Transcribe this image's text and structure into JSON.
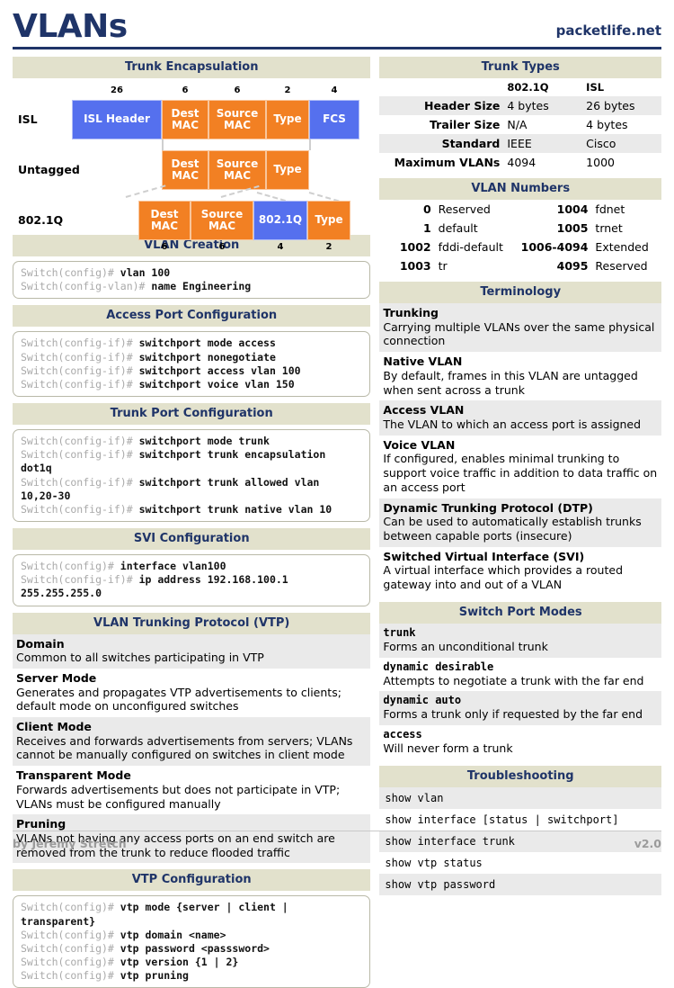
{
  "header": {
    "title": "VLANs",
    "brand": "packetlife.net",
    "accent_color": "#1F3468",
    "band_color": "#E2E1CC"
  },
  "trunk_encapsulation": {
    "heading": "Trunk Encapsulation",
    "rows": [
      {
        "label": "ISL",
        "fields": [
          {
            "text": "ISL Header",
            "size": "26",
            "color": "blue"
          },
          {
            "text": "Dest MAC",
            "size": "6",
            "color": "orange"
          },
          {
            "text": "Source MAC",
            "size": "6",
            "color": "orange"
          },
          {
            "text": "Type",
            "size": "2",
            "color": "orange"
          },
          {
            "text": "FCS",
            "size": "4",
            "color": "blue"
          }
        ]
      },
      {
        "label": "Untagged",
        "fields": [
          {
            "text": "Dest MAC",
            "size": "",
            "color": "orange"
          },
          {
            "text": "Source MAC",
            "size": "",
            "color": "orange"
          },
          {
            "text": "Type",
            "size": "",
            "color": "orange"
          }
        ]
      },
      {
        "label": "802.1Q",
        "fields": [
          {
            "text": "Dest MAC",
            "size": "6",
            "color": "orange"
          },
          {
            "text": "Source MAC",
            "size": "6",
            "color": "orange"
          },
          {
            "text": "802.1Q",
            "size": "4",
            "color": "blue"
          },
          {
            "text": "Type",
            "size": "2",
            "color": "orange"
          }
        ]
      }
    ]
  },
  "vlan_creation": {
    "heading": "VLAN Creation",
    "lines": [
      {
        "prompt": "Switch(config)#",
        "command": "vlan 100"
      },
      {
        "prompt": "Switch(config-vlan)#",
        "command": "name Engineering"
      }
    ]
  },
  "access_port": {
    "heading": "Access Port Configuration",
    "lines": [
      {
        "prompt": "Switch(config-if)#",
        "command": "switchport mode access"
      },
      {
        "prompt": "Switch(config-if)#",
        "command": "switchport nonegotiate"
      },
      {
        "prompt": "Switch(config-if)#",
        "command": "switchport access vlan 100"
      },
      {
        "prompt": "Switch(config-if)#",
        "command": "switchport voice vlan 150"
      }
    ]
  },
  "trunk_port": {
    "heading": "Trunk Port Configuration",
    "lines": [
      {
        "prompt": "Switch(config-if)#",
        "command": "switchport mode trunk"
      },
      {
        "prompt": "Switch(config-if)#",
        "command": "switchport trunk encapsulation dot1q"
      },
      {
        "prompt": "Switch(config-if)#",
        "command": "switchport trunk allowed vlan 10,20-30"
      },
      {
        "prompt": "Switch(config-if)#",
        "command": "switchport trunk native vlan 10"
      }
    ]
  },
  "svi": {
    "heading": "SVI Configuration",
    "lines": [
      {
        "prompt": "Switch(config)#",
        "command": "interface vlan100"
      },
      {
        "prompt": "Switch(config-if)#",
        "command": "ip address 192.168.100.1 255.255.255.0"
      }
    ]
  },
  "vtp": {
    "heading": "VLAN Trunking Protocol (VTP)",
    "entries": [
      {
        "term": "Domain",
        "desc": "Common to all switches participating in VTP"
      },
      {
        "term": "Server Mode",
        "desc": "Generates and propagates VTP advertisements to clients; default mode on unconfigured switches"
      },
      {
        "term": "Client Mode",
        "desc": "Receives and forwards advertisements from servers; VLANs cannot be manually configured on switches in client mode"
      },
      {
        "term": "Transparent Mode",
        "desc": "Forwards advertisements but does not participate in VTP; VLANs must be configured manually"
      },
      {
        "term": "Pruning",
        "desc": "VLANs not having any access ports on an end switch are removed from the trunk to reduce flooded traffic"
      }
    ]
  },
  "vtp_config": {
    "heading": "VTP Configuration",
    "lines": [
      {
        "prompt": "Switch(config)#",
        "command": "vtp mode {server | client | transparent}"
      },
      {
        "prompt": "Switch(config)#",
        "command": "vtp domain <name>"
      },
      {
        "prompt": "Switch(config)#",
        "command": "vtp password <passsword>"
      },
      {
        "prompt": "Switch(config)#",
        "command": "vtp version {1 | 2}"
      },
      {
        "prompt": "Switch(config)#",
        "command": "vtp pruning"
      }
    ]
  },
  "trunk_types": {
    "heading": "Trunk Types",
    "columns": [
      "",
      "802.1Q",
      "ISL"
    ],
    "rows": [
      {
        "label": "Header Size",
        "dot1q": "4 bytes",
        "isl": "26 bytes"
      },
      {
        "label": "Trailer Size",
        "dot1q": "N/A",
        "isl": "4 bytes"
      },
      {
        "label": "Standard",
        "dot1q": "IEEE",
        "isl": "Cisco"
      },
      {
        "label": "Maximum VLANs",
        "dot1q": "4094",
        "isl": "1000"
      }
    ]
  },
  "vlan_numbers": {
    "heading": "VLAN Numbers",
    "rows": [
      {
        "n1": "0",
        "v1": "Reserved",
        "n2": "1004",
        "v2": "fdnet"
      },
      {
        "n1": "1",
        "v1": "default",
        "n2": "1005",
        "v2": "trnet"
      },
      {
        "n1": "1002",
        "v1": "fddi-default",
        "n2": "1006-4094",
        "v2": "Extended"
      },
      {
        "n1": "1003",
        "v1": "tr",
        "n2": "4095",
        "v2": "Reserved"
      }
    ]
  },
  "terminology": {
    "heading": "Terminology",
    "entries": [
      {
        "term": "Trunking",
        "desc": "Carrying multiple VLANs over the same physical connection"
      },
      {
        "term": "Native VLAN",
        "desc": "By default, frames in this VLAN are untagged when sent across a trunk"
      },
      {
        "term": "Access VLAN",
        "desc": "The VLAN to which an access port is assigned"
      },
      {
        "term": "Voice VLAN",
        "desc": "If configured, enables minimal trunking to support voice traffic in addition to data traffic on an access port"
      },
      {
        "term": "Dynamic Trunking Protocol (DTP)",
        "desc": "Can be used to automatically establish trunks between capable ports (insecure)"
      },
      {
        "term": "Switched Virtual Interface (SVI)",
        "desc": "A virtual interface which provides a routed gateway into and out of a VLAN"
      }
    ]
  },
  "switch_port_modes": {
    "heading": "Switch Port Modes",
    "entries": [
      {
        "term": "trunk",
        "desc": "Forms an unconditional trunk"
      },
      {
        "term": "dynamic desirable",
        "desc": "Attempts to negotiate a trunk with the far end"
      },
      {
        "term": "dynamic auto",
        "desc": "Forms a trunk only if requested by the far end"
      },
      {
        "term": "access",
        "desc": "Will never form a trunk"
      }
    ]
  },
  "troubleshooting": {
    "heading": "Troubleshooting",
    "commands": [
      "show vlan",
      "show interface [status | switchport]",
      "show interface trunk",
      "show vtp status",
      "show vtp password"
    ]
  },
  "footer": {
    "author": "by Jeremy Stretch",
    "version": "v2.0"
  }
}
